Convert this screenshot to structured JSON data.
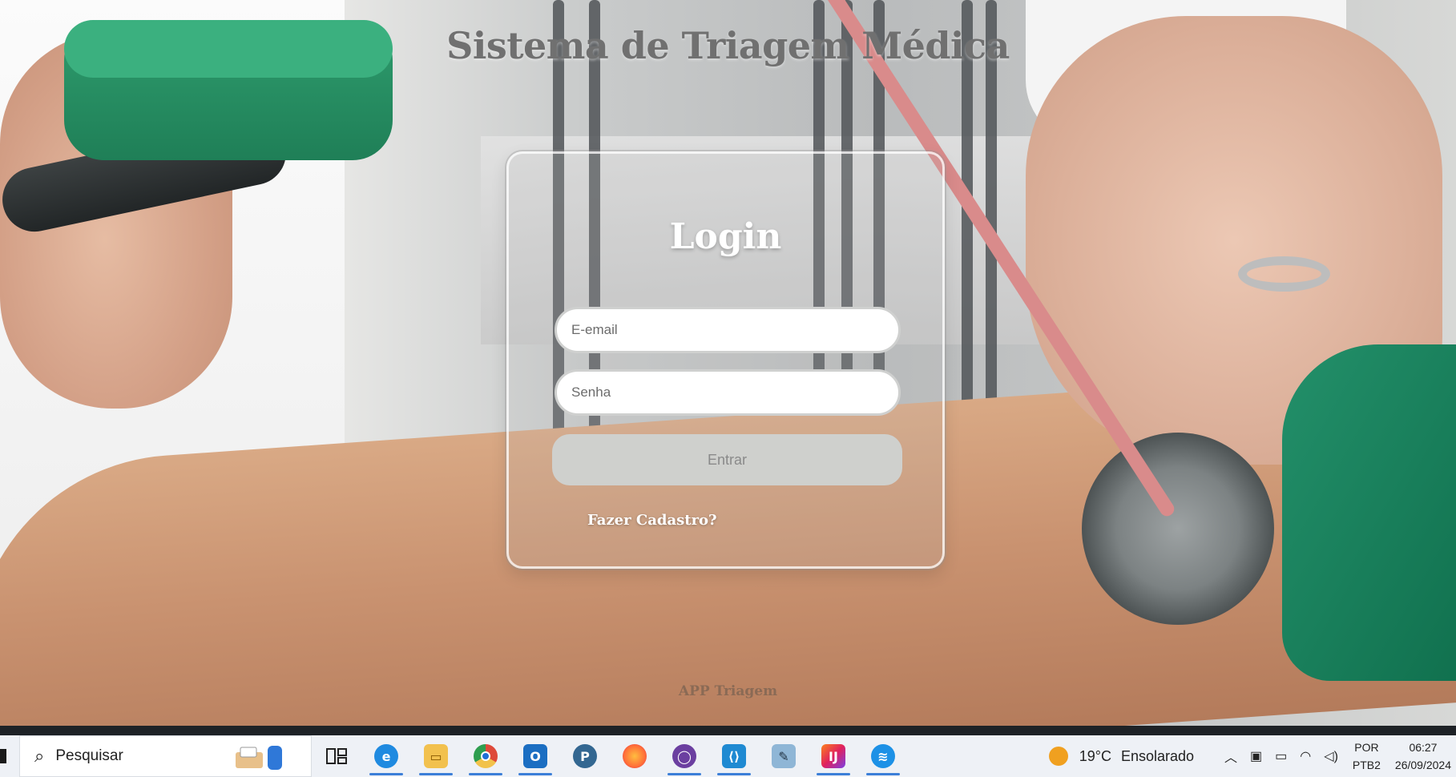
{
  "page": {
    "title": "Sistema de Triagem Médica",
    "footer": "APP Triagem"
  },
  "login": {
    "title": "Login",
    "email_placeholder": "E-email",
    "senha_placeholder": "Senha",
    "submit_label": "Entrar",
    "register_link": "Fazer Cadastro?"
  },
  "taskbar": {
    "search_placeholder": "Pesquisar",
    "apps": [
      {
        "name": "task-view-icon"
      },
      {
        "name": "edge-icon",
        "color": "#1f8ae0"
      },
      {
        "name": "file-explorer-icon",
        "color": "#f2c14e"
      },
      {
        "name": "chrome-icon",
        "color": "#de4a3a"
      },
      {
        "name": "outlook-icon",
        "color": "#1b6ec2"
      },
      {
        "name": "postgresql-icon",
        "color": "#336791"
      },
      {
        "name": "firefox-icon",
        "color": "#ff7139"
      },
      {
        "name": "github-desktop-icon",
        "color": "#6b3fa0"
      },
      {
        "name": "vscode-icon",
        "color": "#1f8ad2"
      },
      {
        "name": "notepad-icon",
        "color": "#6b9fc4"
      },
      {
        "name": "intellij-icon",
        "color": "#e0215e"
      },
      {
        "name": "docker-icon",
        "color": "#1d91e6"
      }
    ],
    "weather": {
      "temp": "19°C",
      "condition": "Ensolarado"
    },
    "language": {
      "line1": "POR",
      "line2": "PTB2"
    },
    "clock": {
      "time": "06:27",
      "date": "26/09/2024"
    }
  }
}
